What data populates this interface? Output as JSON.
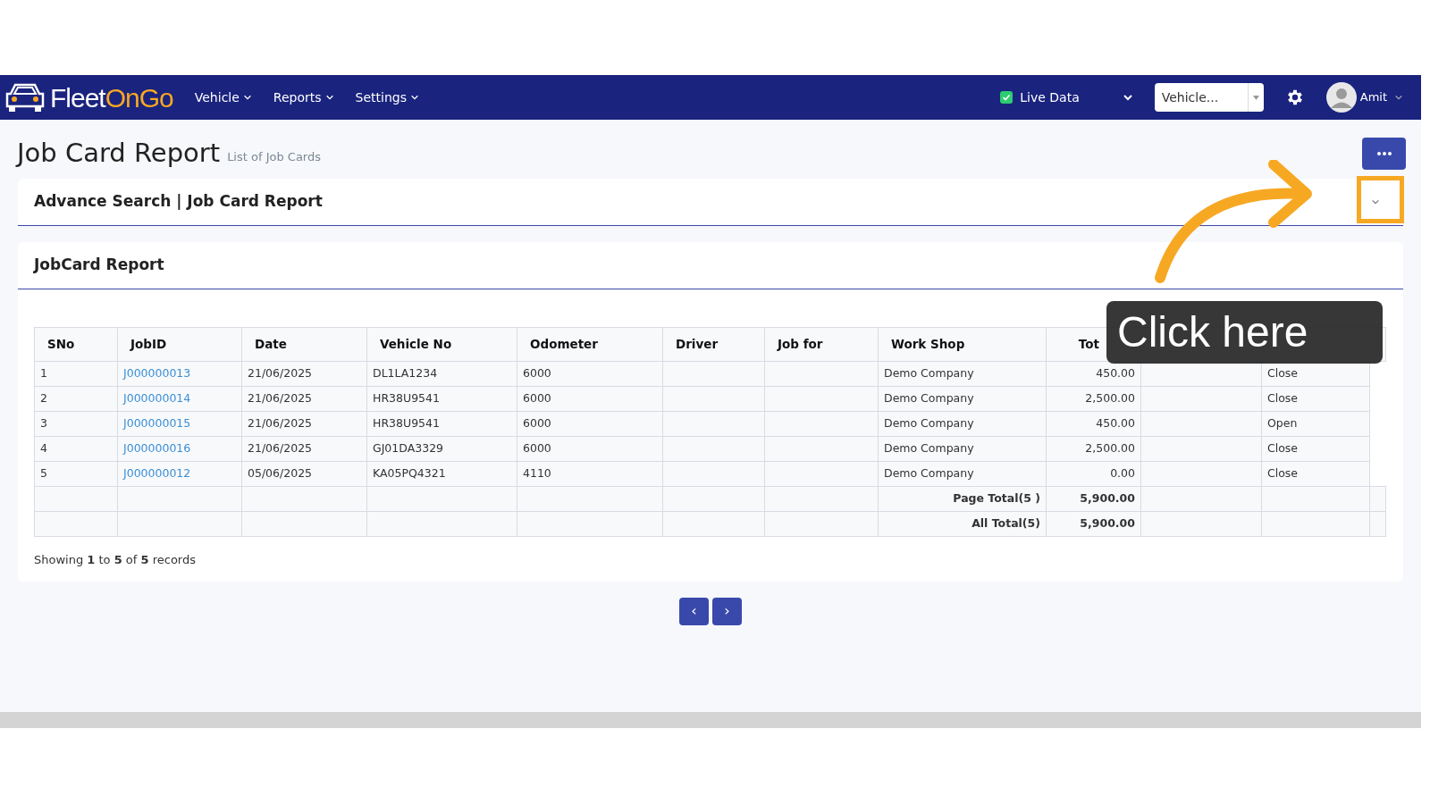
{
  "navbar": {
    "brand_parts": [
      {
        "text": "Fleet",
        "accent": false
      },
      {
        "text": "On",
        "accent": true
      },
      {
        "text": "Go",
        "accent": true
      }
    ],
    "menus": [
      {
        "label": "Vehicle"
      },
      {
        "label": "Reports"
      },
      {
        "label": "Settings"
      }
    ],
    "live_data": {
      "label": "Live Data",
      "checked": true
    },
    "vehicle_select": {
      "placeholder": "Vehicle..."
    },
    "user": {
      "name": "Amit"
    }
  },
  "page": {
    "title": "Job Card Report",
    "subtitle": "List of Job Cards"
  },
  "advance_search": {
    "title": "Advance Search | Job Card Report"
  },
  "report": {
    "title": "JobCard Report",
    "columns": [
      "SNo",
      "JobID",
      "Date",
      "Vehicle No",
      "Odometer",
      "Driver",
      "Job for",
      "Work Shop",
      "Tot"
    ],
    "rows": [
      [
        "1",
        "J000000013",
        "21/06/2025",
        "DL1LA1234",
        "6000",
        "",
        "",
        "Demo Company",
        "450.00",
        "",
        "Close"
      ],
      [
        "2",
        "J000000014",
        "21/06/2025",
        "HR38U9541",
        "6000",
        "",
        "",
        "Demo Company",
        "2,500.00",
        "",
        "Close"
      ],
      [
        "3",
        "J000000015",
        "21/06/2025",
        "HR38U9541",
        "6000",
        "",
        "",
        "Demo Company",
        "450.00",
        "",
        "Open"
      ],
      [
        "4",
        "J000000016",
        "21/06/2025",
        "GJ01DA3329",
        "6000",
        "",
        "",
        "Demo Company",
        "2,500.00",
        "",
        "Close"
      ],
      [
        "5",
        "J000000012",
        "05/06/2025",
        "KA05PQ4321",
        "4110",
        "",
        "",
        "Demo Company",
        "0.00",
        "",
        "Close"
      ]
    ],
    "totals": [
      {
        "label": "Page Total(5 )",
        "value": "5,900.00"
      },
      {
        "label": "All Total(5)",
        "value": "5,900.00"
      }
    ],
    "summary": "Showing **1** to **5** of **5** records"
  },
  "pagination": {
    "previous": "‹",
    "next": "›"
  },
  "callout": {
    "text": "Click here"
  }
}
